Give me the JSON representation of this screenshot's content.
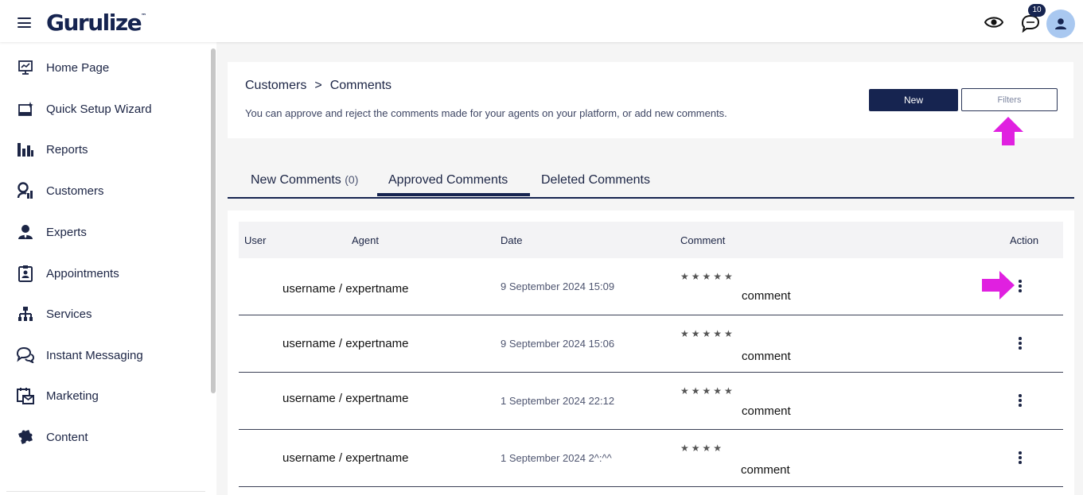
{
  "app": {
    "logo": "Gurulize",
    "logo_mark": "™",
    "notification_count": "10"
  },
  "sidebar": {
    "items": [
      {
        "label": "Home Page",
        "icon": "presentation-chart-icon"
      },
      {
        "label": "Quick Setup Wizard",
        "icon": "wizard-window-icon"
      },
      {
        "label": "Reports",
        "icon": "bar-chart-icon"
      },
      {
        "label": "Customers",
        "icon": "customers-icon"
      },
      {
        "label": "Experts",
        "icon": "expert-user-icon"
      },
      {
        "label": "Appointments",
        "icon": "clipboard-user-icon"
      },
      {
        "label": "Services",
        "icon": "sitemap-icon"
      },
      {
        "label": "Instant Messaging",
        "icon": "chat-bubbles-icon"
      },
      {
        "label": "Marketing",
        "icon": "calendar-mail-icon"
      },
      {
        "label": "Content",
        "icon": "puzzle-icon"
      }
    ]
  },
  "header": {
    "breadcrumb": [
      "Customers",
      ">",
      "Comments"
    ],
    "subtitle": "You can approve and reject the comments made for your agents on your platform, or add new comments.",
    "new_label": "New",
    "filters_label": "Filters"
  },
  "tabs": [
    {
      "label": "New Comments",
      "count": "(0)"
    },
    {
      "label": "Approved Comments",
      "count": ""
    },
    {
      "label": "Deleted Comments",
      "count": ""
    }
  ],
  "table": {
    "columns": [
      "User",
      "Agent",
      "Date",
      "Comment",
      "Action"
    ],
    "rows": [
      {
        "agent": "username / expertname",
        "date": "9 September 2024 15:09",
        "stars": "★★★★★",
        "comment": "comment"
      },
      {
        "agent": "username / expertname",
        "date": "9 September 2024 15:06",
        "stars": "★★★★★",
        "comment": "comment"
      },
      {
        "agent": "username / expertname",
        "date": "1 September 2024 22:12",
        "stars": "★★★★★",
        "comment": "comment"
      },
      {
        "agent": "username / expertname",
        "date": "1 September 2024 2^:^^",
        "stars": "★★★★",
        "comment": "comment"
      }
    ]
  },
  "colors": {
    "primary": "#162450",
    "annotation_arrow": "#e020e0"
  }
}
